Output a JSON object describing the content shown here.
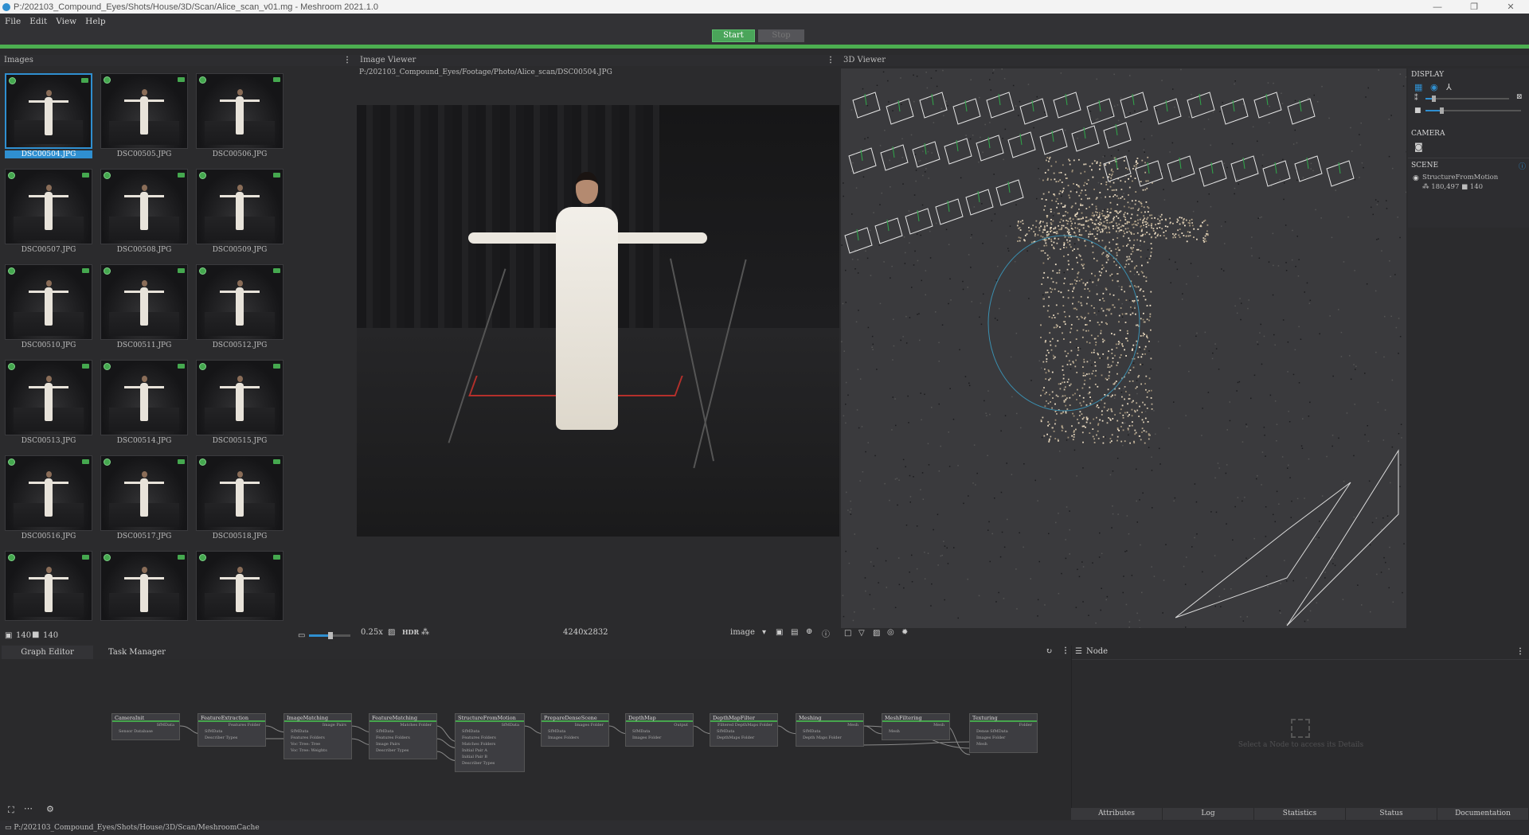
{
  "window": {
    "title": "P:/202103_Compound_Eyes/Shots/House/3D/Scan/Alice_scan_v01.mg - Meshroom 2021.1.0",
    "min": "—",
    "max": "❐",
    "close": "✕"
  },
  "menu": [
    "File",
    "Edit",
    "View",
    "Help"
  ],
  "toolbar": {
    "start": "Start",
    "stop": "Stop"
  },
  "images_panel": {
    "title": "Images",
    "thumbnails": [
      "DSC00504.JPG",
      "DSC00505.JPG",
      "DSC00506.JPG",
      "DSC00507.JPG",
      "DSC00508.JPG",
      "DSC00509.JPG",
      "DSC00510.JPG",
      "DSC00511.JPG",
      "DSC00512.JPG",
      "DSC00513.JPG",
      "DSC00514.JPG",
      "DSC00515.JPG",
      "DSC00516.JPG",
      "DSC00517.JPG",
      "DSC00518.JPG",
      "",
      "",
      ""
    ],
    "image_count": "140",
    "camera_count": "140"
  },
  "image_viewer": {
    "title": "Image Viewer",
    "path": "P:/202103_Compound_Eyes/Footage/Photo/Alice_scan/DSC00504.JPG",
    "zoom": "0.25x",
    "hdr": "HDR",
    "resolution": "4240x2832",
    "mode": "image"
  },
  "viewer_3d": {
    "title": "3D Viewer",
    "display": "DISPLAY",
    "camera": "CAMERA",
    "scene": "SCENE",
    "scene_item": "StructureFromMotion",
    "points": "180,497",
    "cameras": "140"
  },
  "graph_tabs": [
    "Graph Editor",
    "Task Manager"
  ],
  "nodes": [
    {
      "title": "CameraInit",
      "out": "SfMData",
      "ports": [
        "Sensor Database"
      ]
    },
    {
      "title": "FeatureExtraction",
      "out": "Features Folder",
      "ports": [
        "SfMData",
        "Describer Types"
      ]
    },
    {
      "title": "ImageMatching",
      "out": "Image Pairs",
      "ports": [
        "SfMData",
        "Features Folders",
        "Voc Tree: Tree",
        "Voc Tree: Weights"
      ]
    },
    {
      "title": "FeatureMatching",
      "out": "Matches Folder",
      "ports": [
        "SfMData",
        "Features Folders",
        "Image Pairs",
        "Describer Types"
      ]
    },
    {
      "title": "StructureFromMotion",
      "out": "SfMData",
      "ports": [
        "SfMData",
        "Features Folders",
        "Matches Folders",
        "Initial Pair A",
        "Initial Pair B",
        "Describer Types"
      ]
    },
    {
      "title": "PrepareDenseScene",
      "out": "Images Folder",
      "ports": [
        "SfMData",
        "Images Folders"
      ]
    },
    {
      "title": "DepthMap",
      "out": "Output",
      "ports": [
        "SfMData",
        "Images Folder"
      ]
    },
    {
      "title": "DepthMapFilter",
      "out": "Filtered DepthMaps Folder",
      "ports": [
        "SfMData",
        "DepthMaps Folder"
      ]
    },
    {
      "title": "Meshing",
      "out": "Mesh",
      "ports": [
        "SfMData",
        "Depth Maps Folder"
      ]
    },
    {
      "title": "MeshFiltering",
      "out": "Mesh",
      "ports": [
        "Mesh"
      ]
    },
    {
      "title": "Texturing",
      "out": "Folder",
      "ports": [
        "Dense SfMData",
        "Images Folder",
        "Mesh"
      ]
    }
  ],
  "node_panel": {
    "title": "Node",
    "hint": "Select a Node to access its Details",
    "tabs": [
      "Attributes",
      "Log",
      "Statistics",
      "Status",
      "Documentation"
    ]
  },
  "status": {
    "cache": "P:/202103_Compound_Eyes/Shots/House/3D/Scan/MeshroomCache"
  }
}
